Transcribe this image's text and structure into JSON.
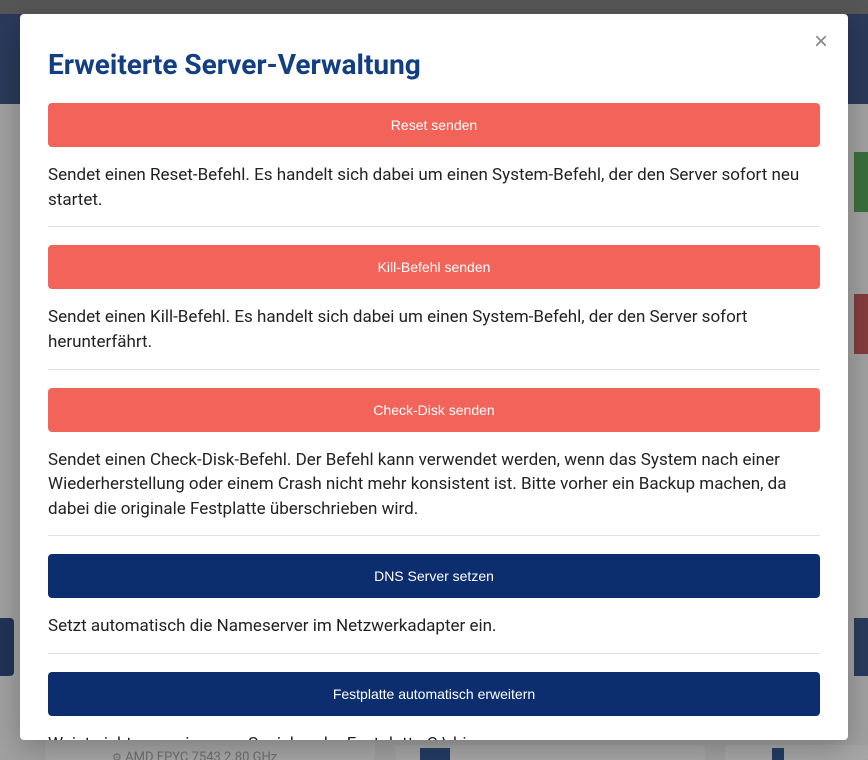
{
  "modal": {
    "title": "Erweiterte Server-Verwaltung",
    "close_label": "×",
    "sections": [
      {
        "button": "Reset senden",
        "style": "red",
        "description": "Sendet einen Reset-Befehl. Es handelt sich dabei um einen System-Befehl, der den Server sofort neu startet."
      },
      {
        "button": "Kill-Befehl senden",
        "style": "red",
        "description": "Sendet einen Kill-Befehl. Es handelt sich dabei um einen System-Befehl, der den Server sofort herunterfährt."
      },
      {
        "button": "Check-Disk senden",
        "style": "red",
        "description": "Sendet einen Check-Disk-Befehl. Der Befehl kann verwendet werden, wenn das System nach einer Wiederherstellung oder einem Crash nicht mehr konsistent ist. Bitte vorher ein Backup machen, da dabei die originale Festplatte überschrieben wird."
      },
      {
        "button": "DNS Server setzen",
        "style": "blue",
        "description": "Setzt automatisch die Nameserver im Netzwerkadapter ein."
      },
      {
        "button": "Festplatte automatisch erweitern",
        "style": "blue",
        "description": "Weist nicht zugewiesenen Speicher der Festplatte C:\\ hinzu."
      }
    ]
  },
  "background": {
    "cpu_line": "AMD EPYC 7543  2.80 GHz"
  }
}
